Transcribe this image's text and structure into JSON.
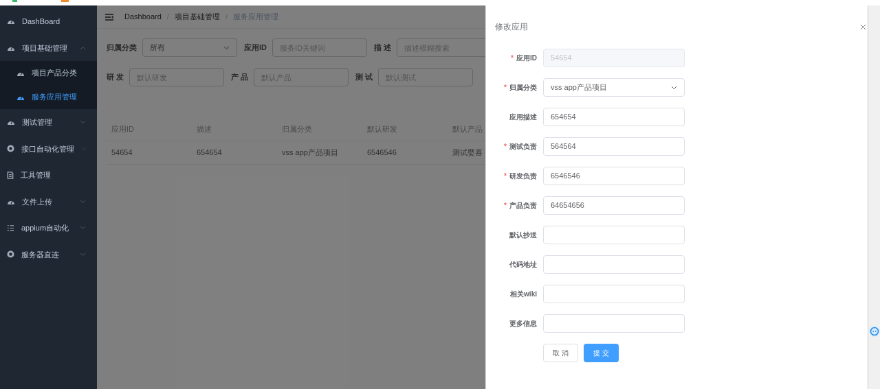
{
  "sidebar": {
    "items": [
      {
        "label": "DashBoard",
        "kind": "link"
      },
      {
        "label": "项目基础管理",
        "kind": "group",
        "expanded": true,
        "children": [
          {
            "label": "项目产品分类",
            "selected": false
          },
          {
            "label": "服务应用管理",
            "selected": true
          }
        ]
      },
      {
        "label": "测试管理",
        "kind": "group",
        "expanded": false
      },
      {
        "label": "接口自动化管理",
        "kind": "group",
        "expanded": false
      },
      {
        "label": "工具管理",
        "kind": "link"
      },
      {
        "label": "文件上传",
        "kind": "group",
        "expanded": false
      },
      {
        "label": "appium自动化",
        "kind": "group",
        "expanded": false
      },
      {
        "label": "服务器直连",
        "kind": "group",
        "expanded": false
      }
    ]
  },
  "breadcrumb": {
    "items": [
      "Dashboard",
      "项目基础管理",
      "服务应用管理"
    ],
    "separator": "/"
  },
  "filters": [
    [
      {
        "label": "归属分类",
        "kind": "select",
        "value": "所有"
      },
      {
        "label": "应用ID",
        "kind": "input",
        "placeholder": "服务ID关键词"
      },
      {
        "label": "描 述",
        "kind": "input",
        "placeholder": "描述模糊搜索"
      }
    ],
    [
      {
        "label": "研 发",
        "kind": "input",
        "placeholder": "默认研发"
      },
      {
        "label": "产 品",
        "kind": "input",
        "placeholder": "默认产品"
      },
      {
        "label": "测 试",
        "kind": "input",
        "placeholder": "默认测试"
      }
    ]
  ],
  "table": {
    "columns": [
      "应用ID",
      "描述",
      "归属分类",
      "默认研发",
      "默认产品"
    ],
    "rows": [
      [
        "54654",
        "654654",
        "vss app产品项目",
        "6546546",
        "测试婴喜"
      ]
    ]
  },
  "drawer": {
    "title": "修改应用",
    "required_mark": "*",
    "fields": [
      {
        "label": "应用ID",
        "required": true,
        "kind": "disabled",
        "value": "54654"
      },
      {
        "label": "归属分类",
        "required": true,
        "kind": "select",
        "value": "vss app产品项目"
      },
      {
        "label": "应用描述",
        "required": false,
        "kind": "input",
        "value": "654654"
      },
      {
        "label": "测试负责",
        "required": true,
        "kind": "input",
        "value": "564564"
      },
      {
        "label": "研发负责",
        "required": true,
        "kind": "input",
        "value": "6546546"
      },
      {
        "label": "产品负责",
        "required": true,
        "kind": "input",
        "value": "64654656"
      },
      {
        "label": "默认抄送",
        "required": false,
        "kind": "input"
      },
      {
        "label": "代码地址",
        "required": false,
        "kind": "input"
      },
      {
        "label": "相关wiki",
        "required": false,
        "kind": "input"
      },
      {
        "label": "更多信息",
        "required": false,
        "kind": "input"
      }
    ],
    "buttons": [
      {
        "label": "取 消",
        "kind": "default"
      },
      {
        "label": "提 交",
        "kind": "primary"
      }
    ]
  }
}
